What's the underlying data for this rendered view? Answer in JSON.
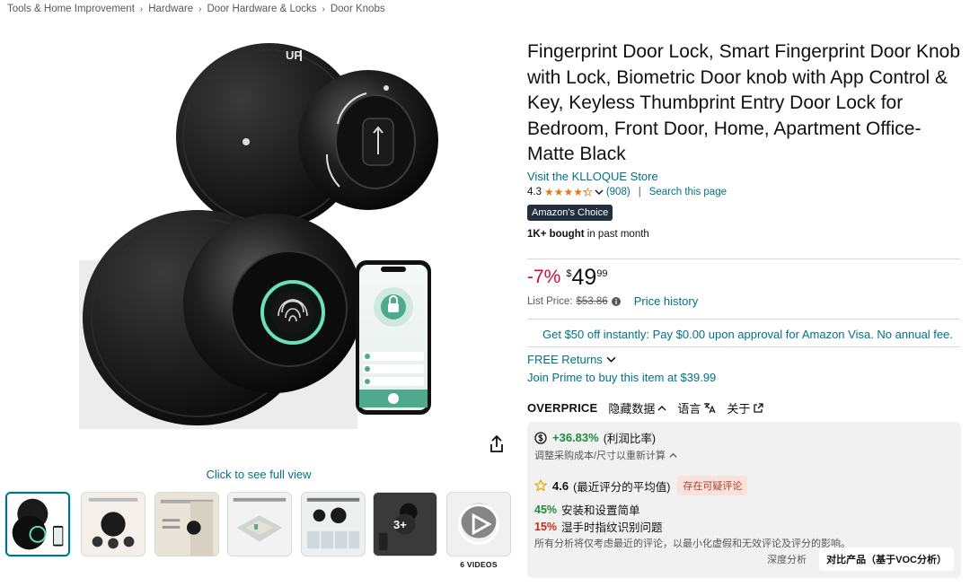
{
  "breadcrumb": [
    "Tools & Home Improvement",
    "Hardware",
    "Door Hardware & Locks",
    "Door Knobs"
  ],
  "image": {
    "engraving": "UP",
    "full_view_label": "Click to see full view",
    "videos_label": "6 VIDEOS",
    "more_count": "3+",
    "phone_items": [
      "Member Management",
      "Smart Scenes",
      "Lock"
    ]
  },
  "product": {
    "title": "Fingerprint Door Lock, Smart Fingerprint Door Knob with Lock, Biometric Door knob with App Control & Key, Keyless Thumbprint Entry Door Lock for Bedroom, Front Door, Home, Apartment Office-Matte Black",
    "store_link": "Visit the KLLOQUE Store",
    "rating": "4.3",
    "rating_value": 4.3,
    "review_count": "(908)",
    "search_page": "Search this page",
    "badge": "Amazon's Choice",
    "bought_bold": "1K+ bought",
    "bought_rest": " in past month"
  },
  "price": {
    "discount": "-7%",
    "currency": "$",
    "whole": "49",
    "fraction": "99",
    "list_label": "List Price:",
    "list_value": "$53.86",
    "history_link": "Price history",
    "visa_offer": "Get $50 off instantly: Pay $0.00 upon approval for Amazon Visa. No annual fee.",
    "free_returns": "FREE Returns",
    "prime": "Join Prime to buy this item at $39.99"
  },
  "overprice": {
    "brand": "OVERPRICE",
    "hide_data": "隐藏数据",
    "language": "语言",
    "about": "关于",
    "profit_value": "+36.83%",
    "profit_label": "(利润比率)",
    "adjust": "调整采购成本/尺寸以重新计算",
    "score": "4.6",
    "score_label": "(最近评分的平均值)",
    "suspect_badge": "存在可疑评论",
    "pos_pct": "45%",
    "pos_text": "安装和设置简单",
    "neg_pct": "15%",
    "neg_text": "湿手时指纹识别问题",
    "footnote": "所有分析将仅考虑最近的评论，以最小化虚假和无效评论及评分的影响。",
    "tab_deep": "深度分析",
    "tab_compare": "对比产品（基于VOC分析）"
  },
  "colors": {
    "link": "#007185",
    "discount": "#cc0c39",
    "star": "#de7921",
    "badge_bg": "#232f3e",
    "profit_green": "#1f8a3b",
    "neg_red": "#cc2a1a"
  }
}
